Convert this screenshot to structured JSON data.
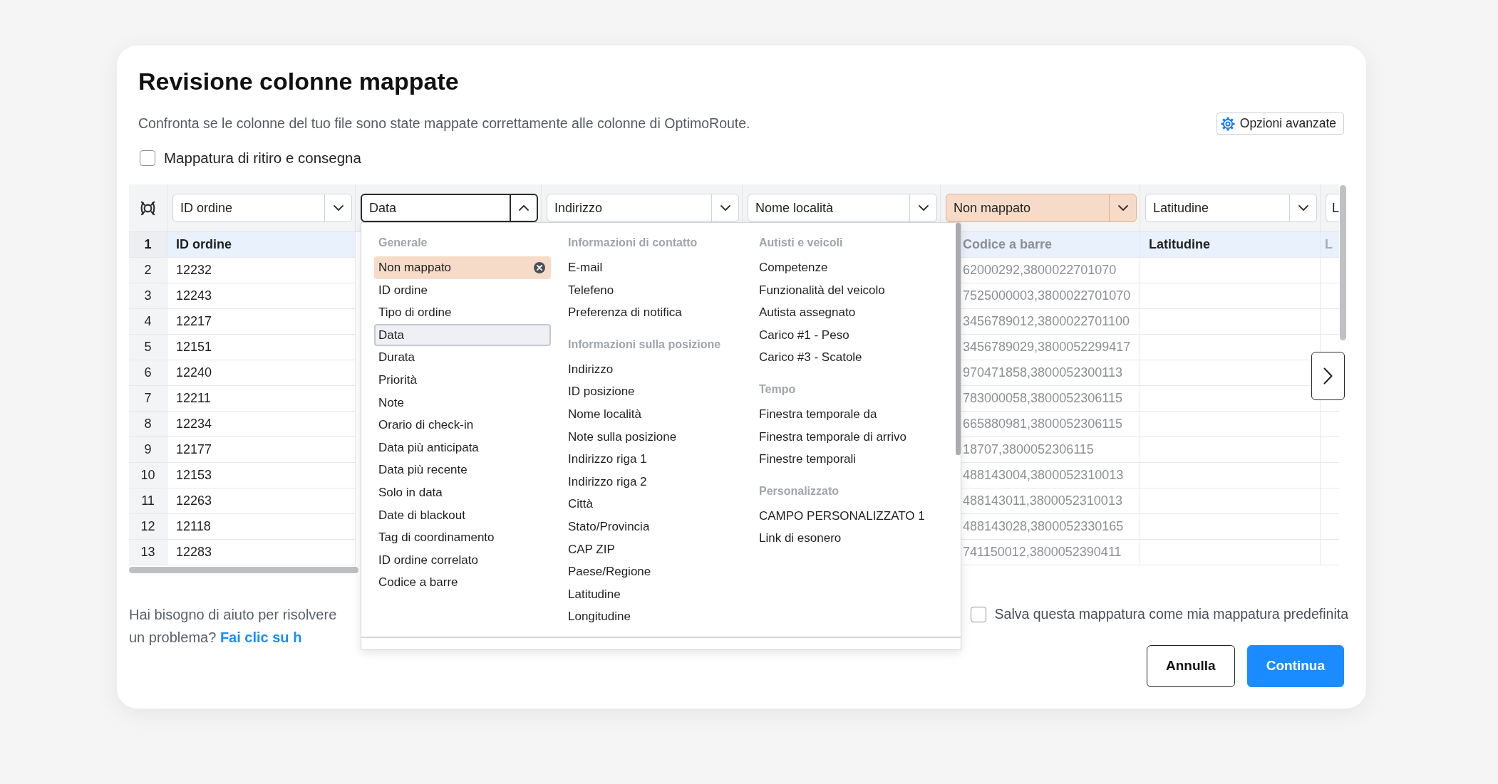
{
  "dialog": {
    "title": "Revisione colonne mappate",
    "description": "Confronta se le colonne del tuo file sono state mappate correttamente alle colonne di OptimoRoute.",
    "advanced_options": "Opzioni avanzate",
    "pickup_delivery": {
      "label": "Mappatura di ritiro e consegna",
      "checked": false
    }
  },
  "table": {
    "row_numbers": [
      "1",
      "2",
      "3",
      "4",
      "5",
      "6",
      "7",
      "8",
      "9",
      "10",
      "11",
      "12",
      "13"
    ],
    "columns": [
      {
        "mapping": "ID ordine",
        "mapped": true,
        "expanded": false,
        "cells": [
          "ID ordine",
          "12232",
          "12243",
          "12217",
          "12151",
          "12240",
          "12211",
          "12234",
          "12177",
          "12153",
          "12263",
          "12118",
          "12283"
        ]
      },
      {
        "mapping": "Data",
        "mapped": true,
        "expanded": true
      },
      {
        "mapping": "Indirizzo",
        "mapped": true,
        "expanded": false
      },
      {
        "mapping": "Nome località",
        "mapped": true,
        "expanded": false
      },
      {
        "mapping": "Non mappato",
        "mapped": false,
        "expanded": false,
        "cells": [
          "Codice a barre",
          "62000292,3800022701070",
          "7525000003,3800022701070",
          "3456789012,3800022701100",
          "3456789029,3800052299417",
          "970471858,3800052300113",
          "783000058,3800052306115",
          "665880981,3800052306115",
          "18707,3800052306115",
          "488143004,3800052310013",
          "488143011,3800052310013",
          "488143028,3800052330165",
          "741150012,3800052390411"
        ]
      },
      {
        "mapping": "Latitudine",
        "mapped": true,
        "expanded": false,
        "cells": [
          "Latitudine"
        ]
      },
      {
        "mapping": "L",
        "mapped": true,
        "expanded": false,
        "cells": [
          "L"
        ]
      }
    ]
  },
  "menu": {
    "columns": [
      {
        "groups": [
          {
            "heading": "Generale",
            "items": [
              {
                "label": "Non mappato",
                "kind": "unmapped",
                "selected": false
              },
              {
                "label": "ID ordine",
                "kind": "field",
                "selected": false
              },
              {
                "label": "Tipo di ordine",
                "kind": "field",
                "selected": false
              },
              {
                "label": "Data",
                "kind": "field",
                "selected": true
              },
              {
                "label": "Durata",
                "kind": "field",
                "selected": false
              },
              {
                "label": "Priorità",
                "kind": "field",
                "selected": false
              },
              {
                "label": "Note",
                "kind": "field",
                "selected": false
              },
              {
                "label": "Orario di check-in",
                "kind": "field",
                "selected": false
              },
              {
                "label": "Data più anticipata",
                "kind": "field",
                "selected": false
              },
              {
                "label": "Data più recente",
                "kind": "field",
                "selected": false
              },
              {
                "label": "Solo in data",
                "kind": "field",
                "selected": false
              },
              {
                "label": "Date di blackout",
                "kind": "field",
                "selected": false
              },
              {
                "label": "Tag di coordinamento",
                "kind": "field",
                "selected": false
              },
              {
                "label": "ID ordine correlato",
                "kind": "field",
                "selected": false
              },
              {
                "label": "Codice a barre",
                "kind": "field",
                "selected": false
              }
            ]
          }
        ]
      },
      {
        "groups": [
          {
            "heading": "Informazioni di contatto",
            "items": [
              {
                "label": "E-mail",
                "selected": false
              },
              {
                "label": "Telefeno",
                "selected": false
              },
              {
                "label": "Preferenza di notifica",
                "selected": false
              }
            ]
          },
          {
            "heading": "Informazioni sulla posizione",
            "items": [
              {
                "label": "Indirizzo",
                "selected": false
              },
              {
                "label": "ID posizione",
                "selected": false
              },
              {
                "label": "Nome località",
                "selected": false
              },
              {
                "label": "Note sulla posizione",
                "selected": false
              },
              {
                "label": "Indirizzo riga 1",
                "selected": false
              },
              {
                "label": "Indirizzo riga 2",
                "selected": false
              },
              {
                "label": "Città",
                "selected": false
              },
              {
                "label": "Stato/Provincia",
                "selected": false
              },
              {
                "label": "CAP ZIP",
                "selected": false
              },
              {
                "label": "Paese/Regione",
                "selected": false
              },
              {
                "label": "Latitudine",
                "selected": false
              },
              {
                "label": "Longitudine",
                "selected": false
              }
            ]
          }
        ]
      },
      {
        "groups": [
          {
            "heading": "Autisti e veicoli",
            "items": [
              {
                "label": "Competenze",
                "selected": false
              },
              {
                "label": "Funzionalità del veicolo",
                "selected": false
              },
              {
                "label": "Autista assegnato",
                "selected": false
              },
              {
                "label": "Carico #1 - Peso",
                "selected": false
              },
              {
                "label": "Carico #3 - Scatole",
                "selected": false
              }
            ]
          },
          {
            "heading": "Tempo",
            "items": [
              {
                "label": "Finestra temporale da",
                "selected": false
              },
              {
                "label": "Finestra temporale di arrivo",
                "selected": false
              },
              {
                "label": "Finestre temporali",
                "selected": false
              }
            ]
          },
          {
            "heading": "Personalizzato",
            "items": [
              {
                "label": "CAMPO PERSONALIZZATO 1",
                "selected": false
              },
              {
                "label": "Link di esonero",
                "selected": false
              }
            ]
          }
        ]
      }
    ]
  },
  "help": {
    "text": "Hai bisogno di aiuto per risolvere un problema?",
    "link": "Fai clic su h"
  },
  "save_default": {
    "label": "Salva questa mappatura come mia mappatura predefinita",
    "checked": false
  },
  "buttons": [
    {
      "label": "Annulla",
      "kind": "secondary"
    },
    {
      "label": "Continua",
      "kind": "primary"
    }
  ]
}
